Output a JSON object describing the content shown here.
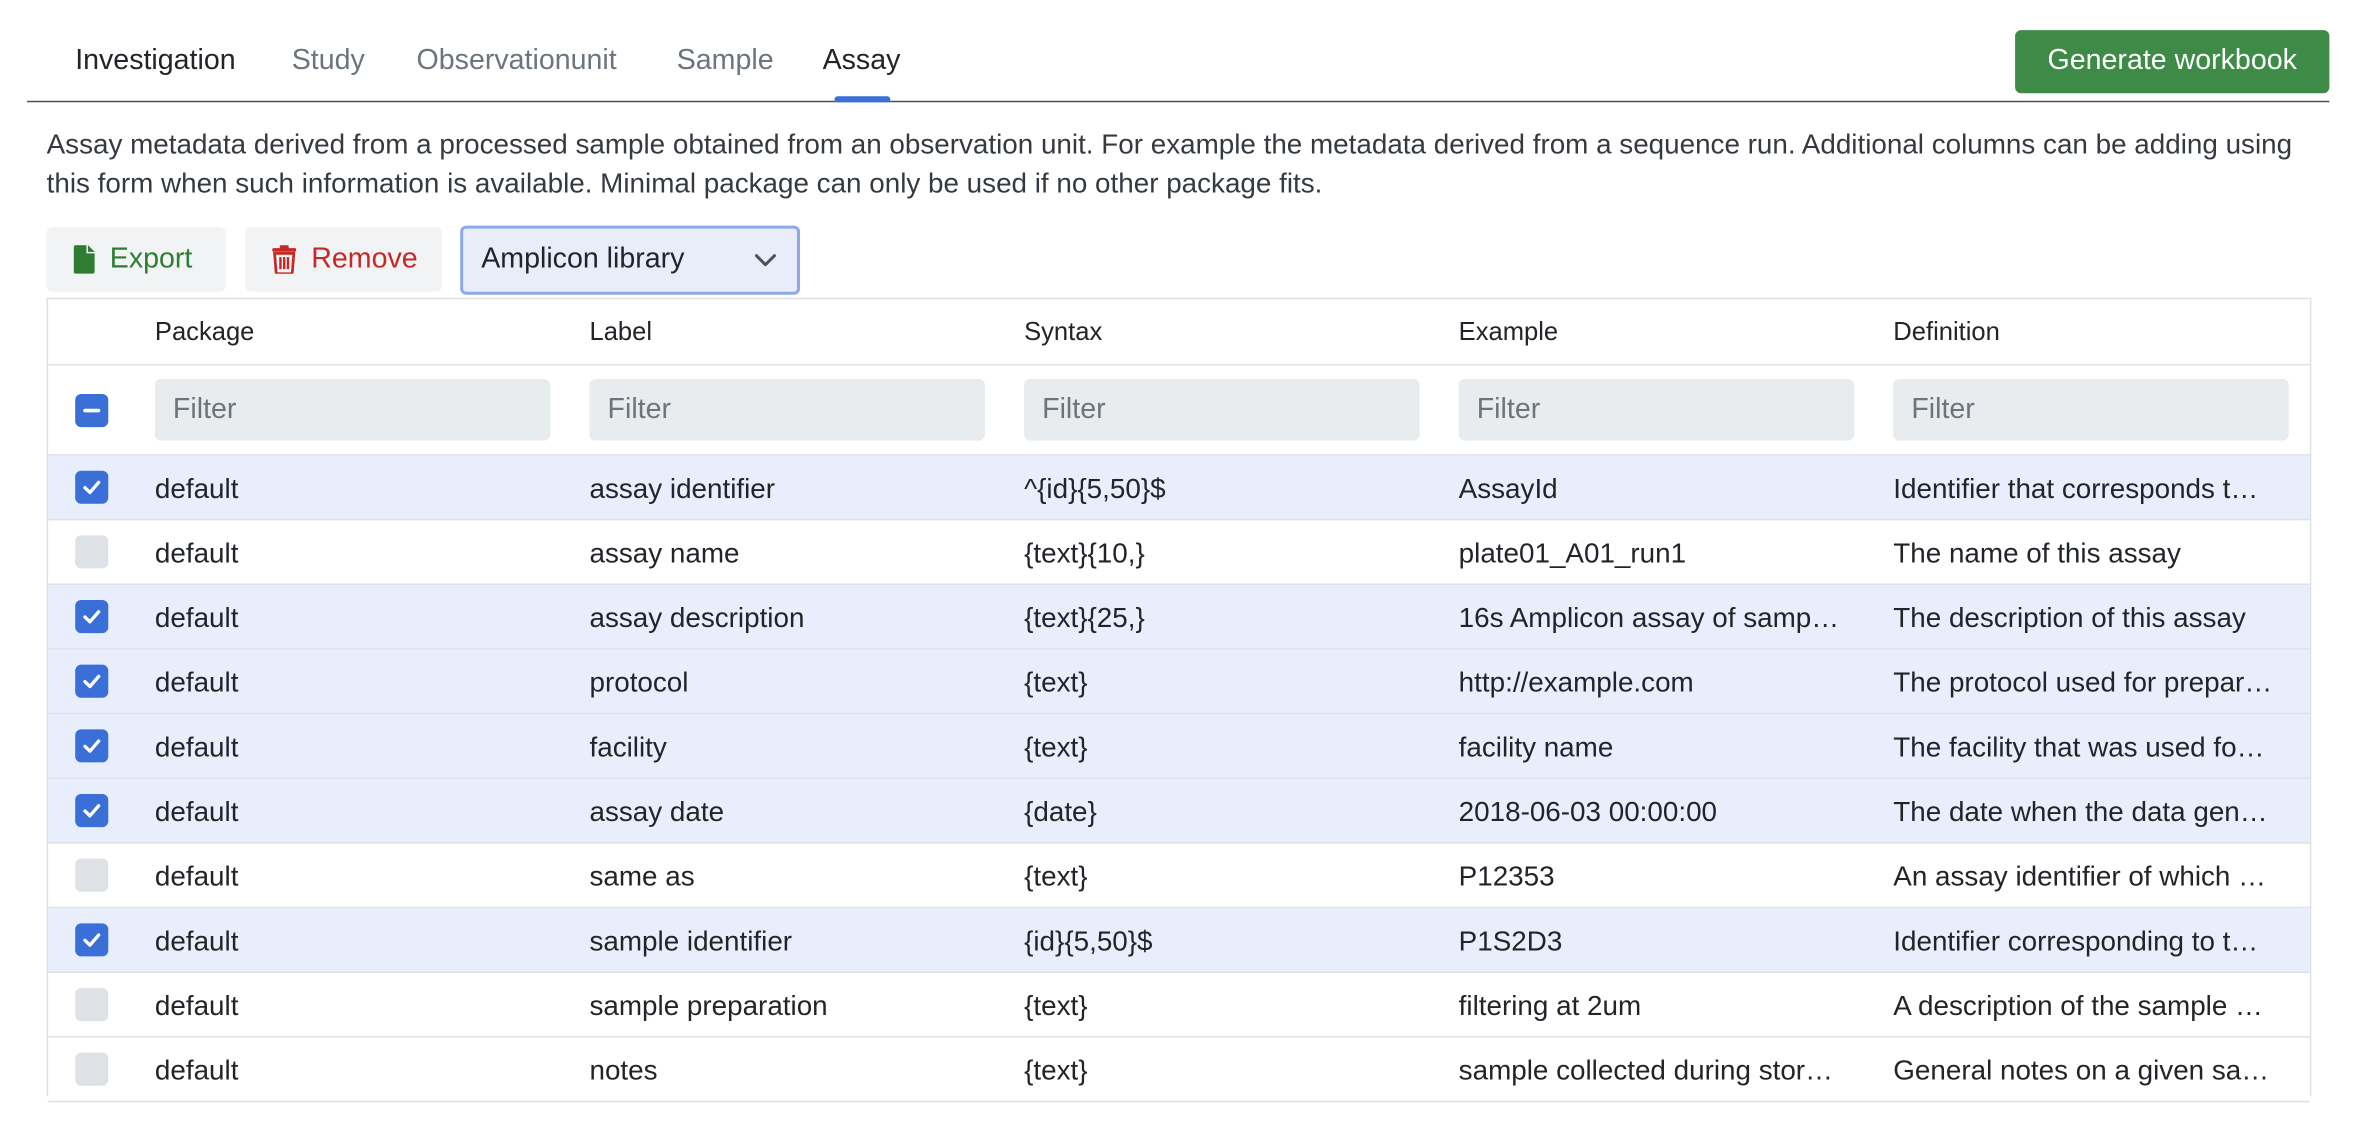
{
  "tabs": [
    {
      "label": "Investigation",
      "active": false
    },
    {
      "label": "Study",
      "active": false
    },
    {
      "label": "Observationunit",
      "active": false
    },
    {
      "label": "Sample",
      "active": false
    },
    {
      "label": "Assay",
      "active": true
    }
  ],
  "generate_button": "Generate workbook",
  "description": "Assay metadata derived from a processed sample obtained from an observation unit. For example the metadata derived from a sequence run. Additional columns can be adding using this form when such information is available. Minimal package can only be used if no other package fits.",
  "toolbar": {
    "export_label": "Export",
    "export_icon": "file-icon",
    "remove_label": "Remove",
    "remove_icon": "trash-icon",
    "package_select": "Amplicon library"
  },
  "colors": {
    "accent": "#3b6fd8",
    "generate_button_bg": "#3d8b47",
    "export_text": "#2e7d32",
    "remove_text": "#c62828",
    "selected_row_bg": "#e8eefb"
  },
  "table": {
    "columns": [
      "Package",
      "Label",
      "Syntax",
      "Example",
      "Definition"
    ],
    "filter_placeholder": "Filter",
    "header_checkbox_state": "indeterminate",
    "rows": [
      {
        "selected": true,
        "package": "default",
        "label": "assay identifier",
        "syntax": "^{id}{5,50}$",
        "example": "AssayId",
        "definition": "Identifier that corresponds t…"
      },
      {
        "selected": false,
        "package": "default",
        "label": "assay name",
        "syntax": "{text}{10,}",
        "example": "plate01_A01_run1",
        "definition": "The name of this assay"
      },
      {
        "selected": true,
        "package": "default",
        "label": "assay description",
        "syntax": "{text}{25,}",
        "example": "16s Amplicon assay of samp…",
        "definition": "The description of this assay"
      },
      {
        "selected": true,
        "package": "default",
        "label": "protocol",
        "syntax": "{text}",
        "example": "http://example.com",
        "definition": "The protocol used for prepar…"
      },
      {
        "selected": true,
        "package": "default",
        "label": "facility",
        "syntax": "{text}",
        "example": "facility name",
        "definition": "The facility that was used fo…"
      },
      {
        "selected": true,
        "package": "default",
        "label": "assay date",
        "syntax": "{date}",
        "example": "2018-06-03 00:00:00",
        "definition": "The date when the data gen…"
      },
      {
        "selected": false,
        "package": "default",
        "label": "same as",
        "syntax": "{text}",
        "example": "P12353",
        "definition": "An assay identifier of which …"
      },
      {
        "selected": true,
        "package": "default",
        "label": "sample identifier",
        "syntax": "{id}{5,50}$",
        "example": "P1S2D3",
        "definition": "Identifier corresponding to t…"
      },
      {
        "selected": false,
        "package": "default",
        "label": "sample preparation",
        "syntax": "{text}",
        "example": "filtering at 2um",
        "definition": "A description of the sample …"
      },
      {
        "selected": false,
        "package": "default",
        "label": "notes",
        "syntax": "{text}",
        "example": "sample collected during stor…",
        "definition": "General notes on a given sa…"
      }
    ]
  }
}
